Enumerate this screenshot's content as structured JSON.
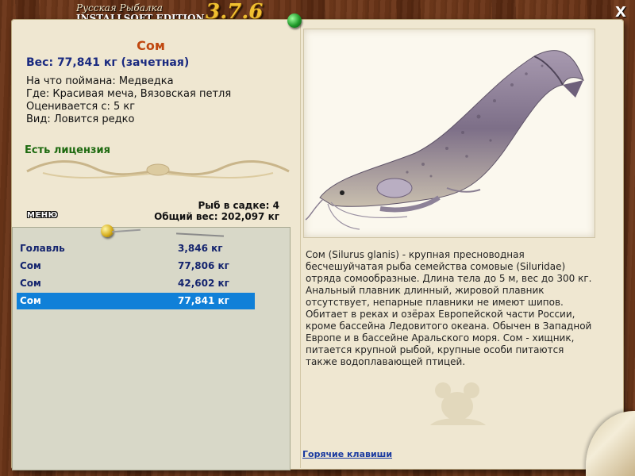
{
  "header": {
    "brand_subtitle": "Русская Рыбалка",
    "brand_title": "INSTALLSOFT EDITION",
    "version": "3.7.6",
    "close_label": "X"
  },
  "fish_info": {
    "title": "Сом",
    "weight_line": "Вес: 77,841 кг (зачетная)",
    "bait_line": "На что поймана: Медведка",
    "location_line": "Где: Красивая меча, Вязовская петля",
    "rated_line": "Оценивается с: 5 кг",
    "species_line": "Вид: Ловится редко",
    "license": "Есть лицензия"
  },
  "summary": {
    "count_line": "Рыб в садке: 4",
    "total_line": "Общий вес: 202,097 кг"
  },
  "menu_label": "МЕНЮ",
  "catches": [
    {
      "name": "Голавль",
      "weight": "3,846 кг",
      "selected": false
    },
    {
      "name": "Сом",
      "weight": "77,806 кг",
      "selected": false
    },
    {
      "name": "Сом",
      "weight": "42,602 кг",
      "selected": false
    },
    {
      "name": "Сом",
      "weight": "77,841 кг",
      "selected": true
    }
  ],
  "description": "Сом (Silurus glanis) - крупная пресноводная бесчешуйчатая рыба семейства сомовые (Siluridae) отряда сомообразные. Длина тела до 5 м, вес до 300 кг. Анальный плавник длинный, жировой плавник отсутствует, непарные плавники не имеют шипов. Обитает в реках и озёрах Европейской части России, кроме бассейна Ледовитого океана. Обычен в Западной Европе и в бассейне Аральского моря. Сом - хищник, питается крупной рыбой, крупные особи питаются также водоплавающей птицей.",
  "hotkeys_label": "Горячие клавиши",
  "colors": {
    "title": "#c04810",
    "weight": "#1a2a80",
    "license": "#1e6a10",
    "selection": "#1080d8",
    "list_bg": "#d8d8c8",
    "parchment": "#efe7d1"
  },
  "icons": {
    "close": "close-icon",
    "green_pin": "green-pin-icon",
    "yellow_pin": "yellow-pin-icon",
    "fish_photo": "catfish-illustration",
    "watermark": "mouse-watermark-icon"
  }
}
